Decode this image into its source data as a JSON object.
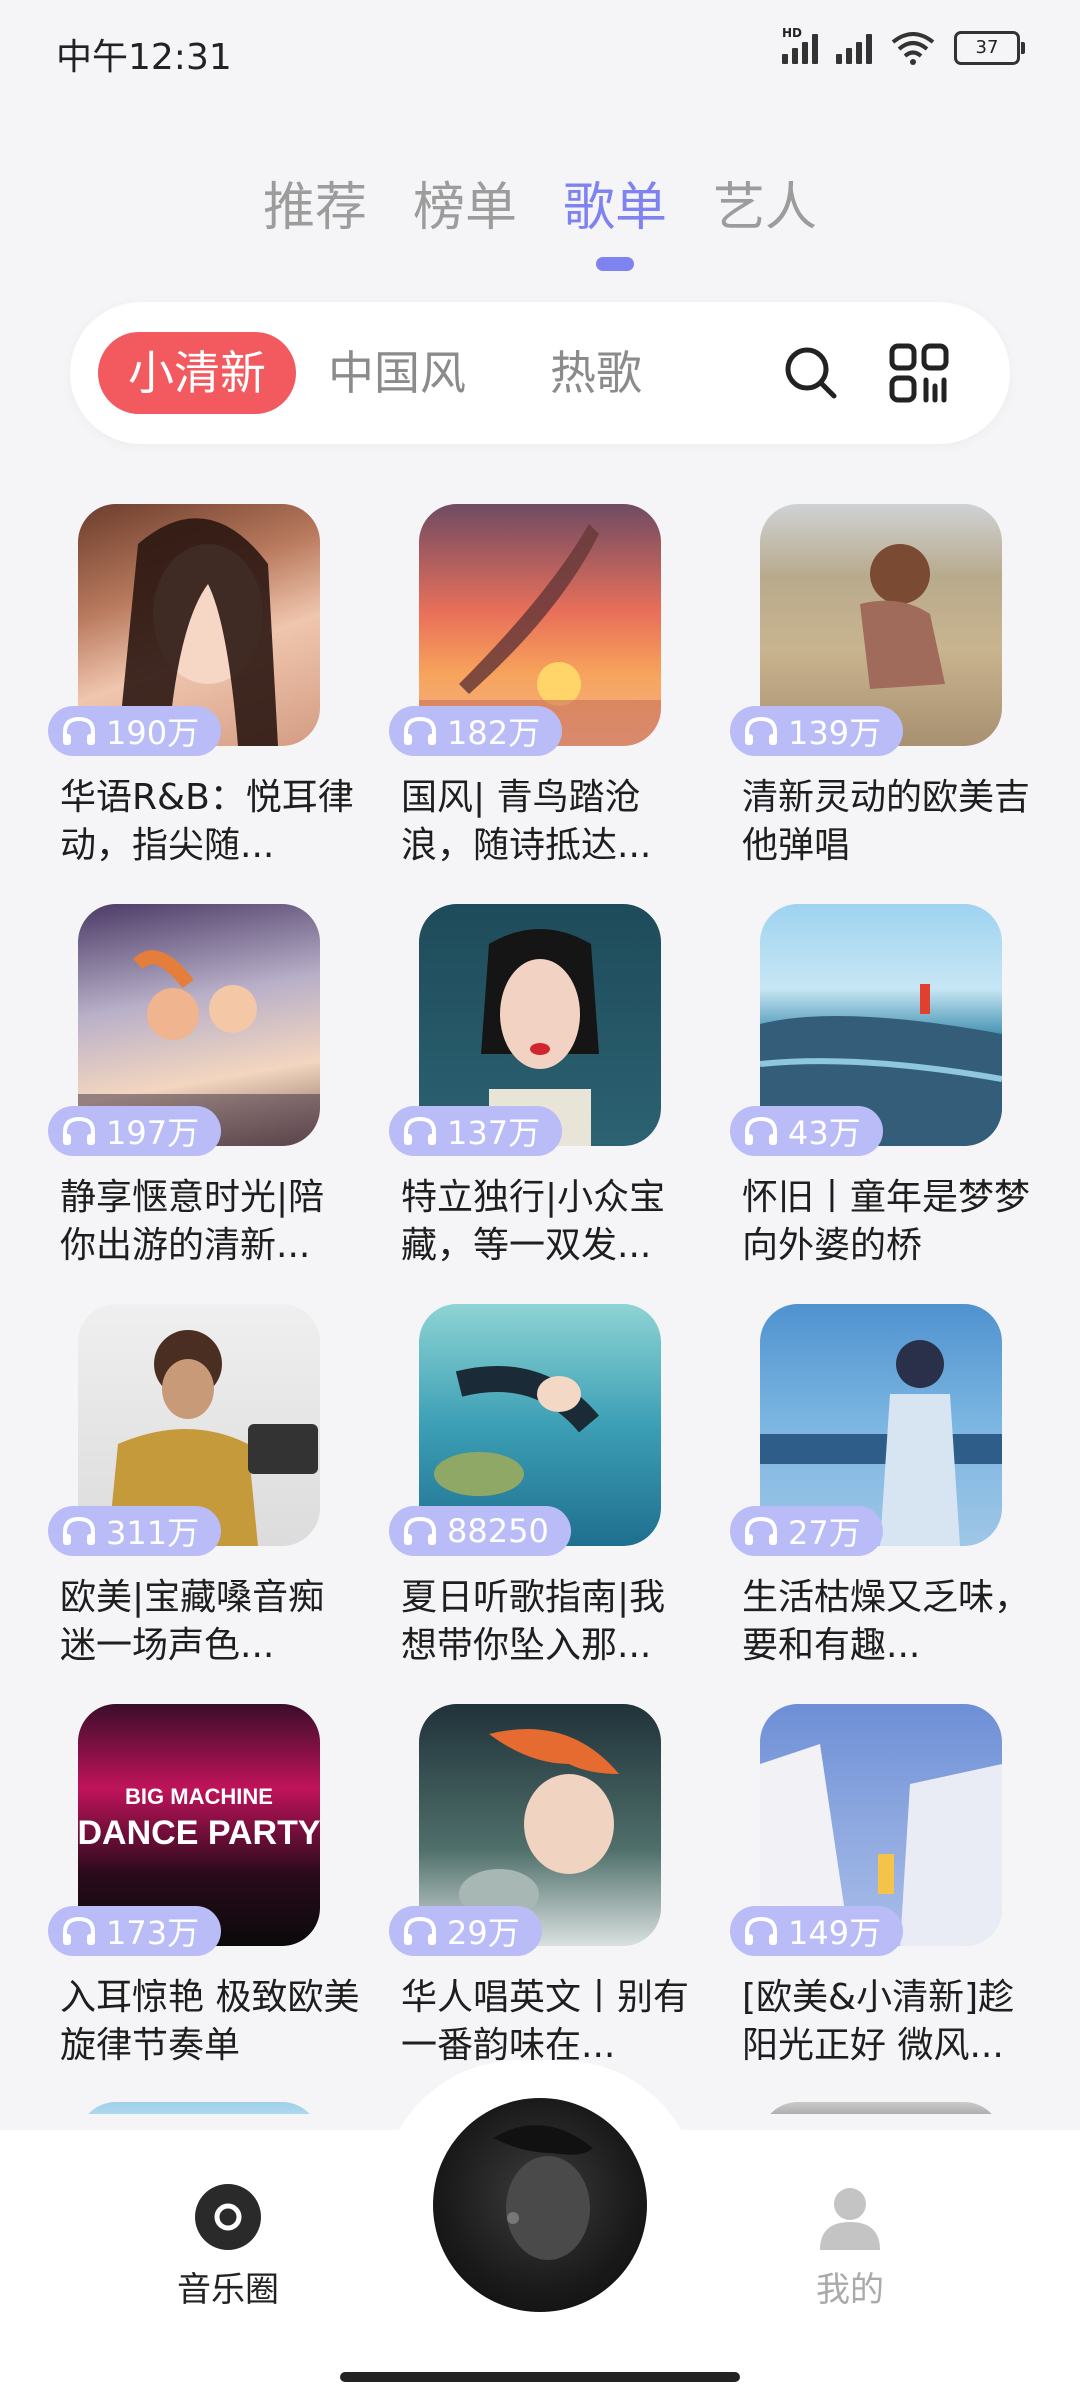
{
  "status": {
    "time": "中午12:31",
    "battery": "37"
  },
  "main_tabs": [
    {
      "label": "推荐",
      "active": false
    },
    {
      "label": "榜单",
      "active": false
    },
    {
      "label": "歌单",
      "active": true
    },
    {
      "label": "艺人",
      "active": false
    }
  ],
  "sub_tabs": [
    {
      "label": "小清新",
      "active": true
    },
    {
      "label": "中国风",
      "active": false
    },
    {
      "label": "热歌",
      "active": false
    }
  ],
  "icons": {
    "search": "search-icon",
    "qr": "qr-scan-icon",
    "headphone": "headphone-icon"
  },
  "colors": {
    "accent": "#7f83f0",
    "chip_active": "#f35a5f",
    "pill": "#b9bcf7"
  },
  "playlists": [
    {
      "plays": "190万",
      "title": "华语R&B：悦耳律动，指尖随..."
    },
    {
      "plays": "182万",
      "title": "国风| 青鸟踏沧浪，随诗抵达..."
    },
    {
      "plays": "139万",
      "title": "清新灵动的欧美吉他弹唱"
    },
    {
      "plays": "197万",
      "title": "静享惬意时光|陪你出游的清新..."
    },
    {
      "plays": "137万",
      "title": "特立独行|小众宝藏，等一双发..."
    },
    {
      "plays": "43万",
      "title": "怀旧丨童年是梦梦向外婆的桥"
    },
    {
      "plays": "311万",
      "title": "欧美|宝藏嗓音痴迷一场声色..."
    },
    {
      "plays": "88250",
      "title": "夏日听歌指南|我想带你坠入那..."
    },
    {
      "plays": "27万",
      "title": "生活枯燥又乏味，要和有趣..."
    },
    {
      "plays": "173万",
      "title": "入耳惊艳 极致欧美旋律节奏单"
    },
    {
      "plays": "29万",
      "title": "华人唱英文丨别有一番韵味在..."
    },
    {
      "plays": "149万",
      "title": "[欧美&小清新]趁阳光正好 微风..."
    }
  ],
  "cover_text": {
    "dance_line1": "BIG MACHINE",
    "dance_line2": "DANCE PARTY"
  },
  "bottom_nav": {
    "left_label": "音乐圈",
    "right_label": "我的"
  }
}
